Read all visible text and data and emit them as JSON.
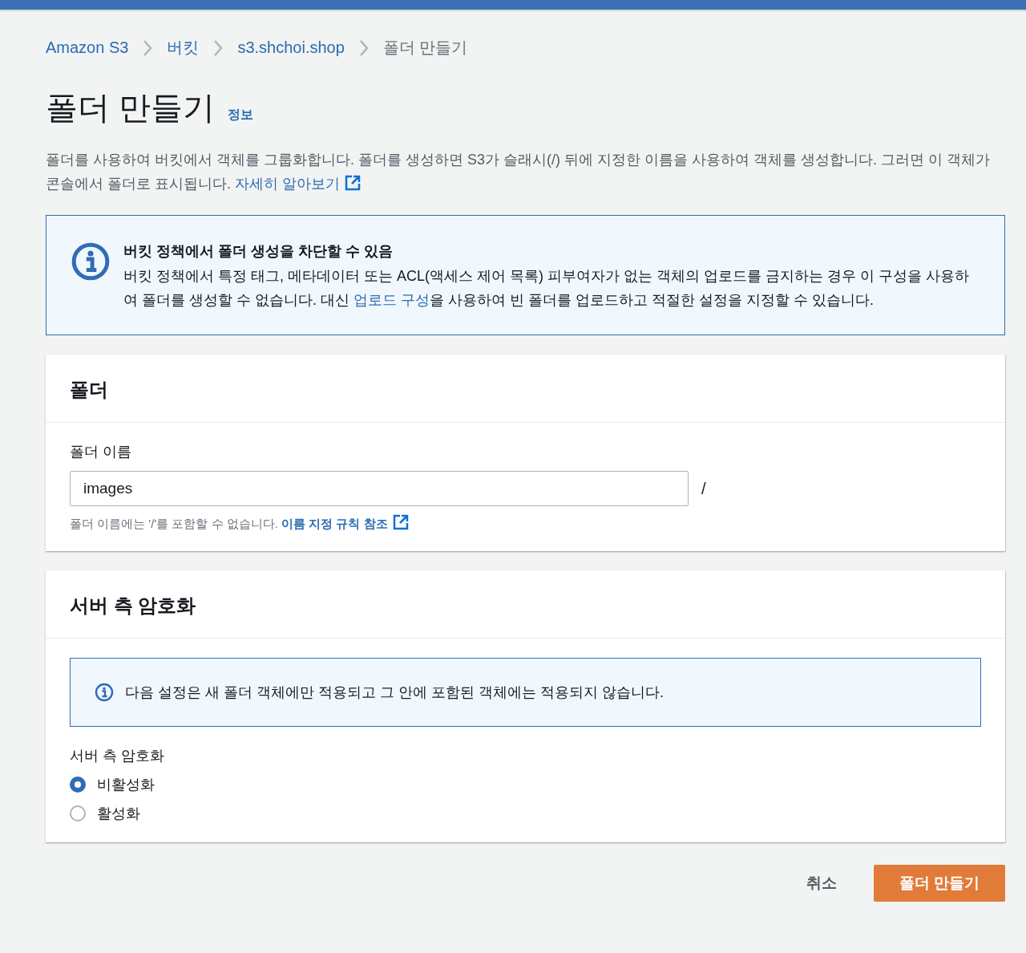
{
  "breadcrumbs": [
    {
      "label": "Amazon S3",
      "current": false
    },
    {
      "label": "버킷",
      "current": false
    },
    {
      "label": "s3.shchoi.shop",
      "current": false
    },
    {
      "label": "폴더 만들기",
      "current": true
    }
  ],
  "page": {
    "title": "폴더 만들기",
    "info_link": "정보",
    "description": "폴더를 사용하여 버킷에서 객체를 그룹화합니다. 폴더를 생성하면 S3가 슬래시(/) 뒤에 지정한 이름을 사용하여 객체를 생성합니다. 그러면 이 객체가 콘솔에서 폴더로 표시됩니다.",
    "description_link": "자세히 알아보기"
  },
  "alert": {
    "title": "버킷 정책에서 폴더 생성을 차단할 수 있음",
    "text_before": "버킷 정책에서 특정 태그, 메타데이터 또는 ACL(액세스 제어 목록) 피부여자가 없는 객체의 업로드를 금지하는 경우 이 구성을 사용하여 폴더를 생성할 수 없습니다. 대신 ",
    "link": "업로드 구성",
    "text_after": "을 사용하여 빈 폴더를 업로드하고 적절한 설정을 지정할 수 있습니다."
  },
  "folder_panel": {
    "title": "폴더",
    "field_label": "폴더 이름",
    "value": "images",
    "suffix": "/",
    "hint": "폴더 이름에는 '/'를 포함할 수 없습니다.",
    "hint_link": "이름 지정 규칙 참조"
  },
  "encryption_panel": {
    "title": "서버 측 암호화",
    "notice": "다음 설정은 새 폴더 객체에만 적용되고 그 안에 포함된 객체에는 적용되지 않습니다.",
    "group_label": "서버 측 암호화",
    "options": [
      {
        "label": "비활성화",
        "selected": true
      },
      {
        "label": "활성화",
        "selected": false
      }
    ]
  },
  "buttons": {
    "cancel": "취소",
    "submit": "폴더 만들기"
  }
}
